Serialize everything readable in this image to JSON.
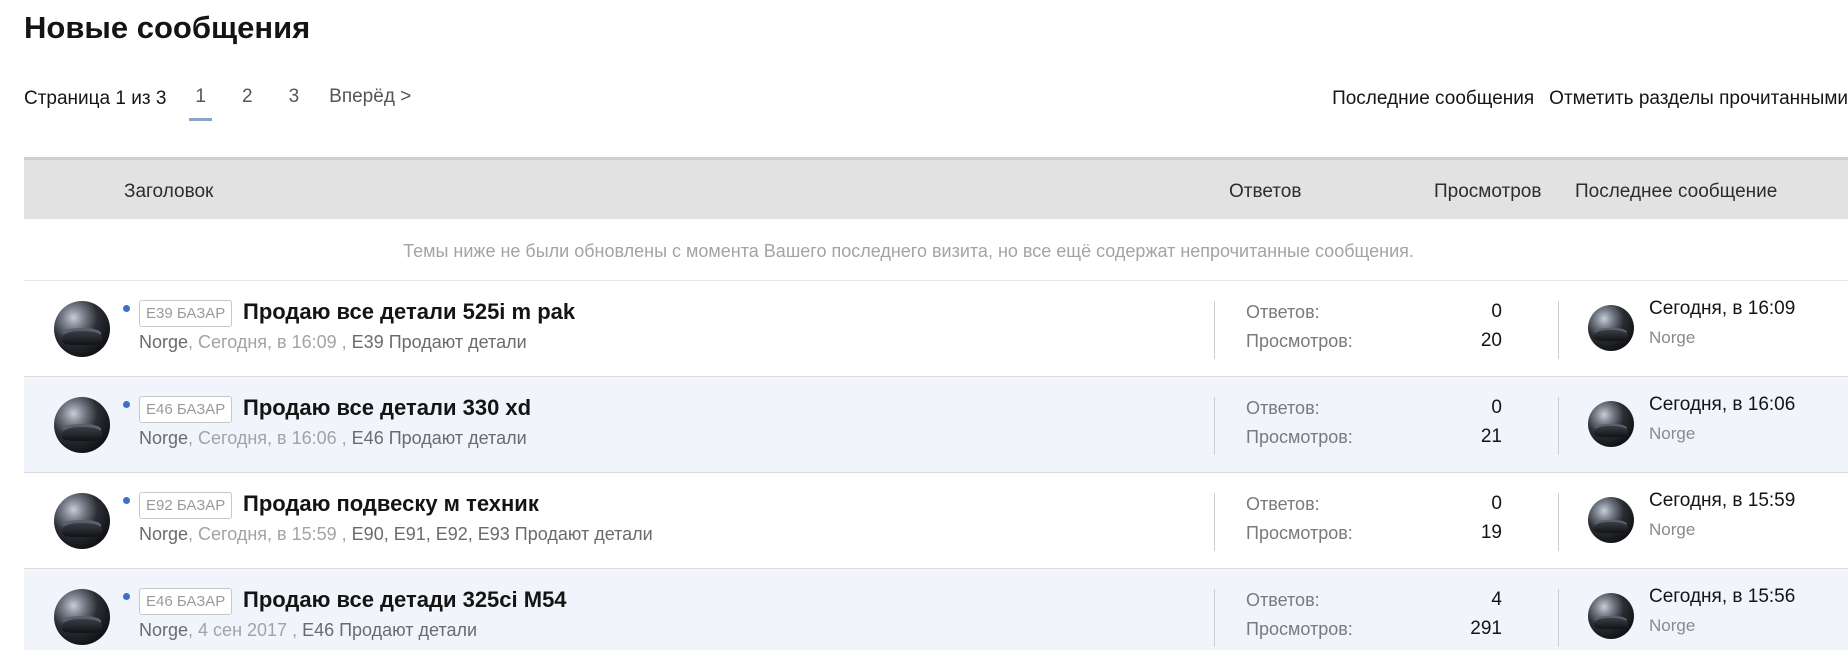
{
  "page": {
    "title": "Новые сообщения"
  },
  "pagination": {
    "label": "Страница 1 из 3",
    "pages": [
      "1",
      "2",
      "3"
    ],
    "current": "1",
    "next": "Вперёд >"
  },
  "top_links": {
    "recent_posts": "Последние сообщения",
    "mark_read": "Отметить разделы прочитанными"
  },
  "table": {
    "headers": {
      "title": "Заголовок",
      "replies": "Ответов",
      "views": "Просмотров",
      "last_post": "Последнее сообщение"
    },
    "notice": "Темы ниже не были обновлены с момента Вашего последнего визита, но все ещё содержат непрочитанные сообщения.",
    "stat_labels": {
      "replies": "Ответов:",
      "views": "Просмотров:"
    },
    "rows": [
      {
        "prefix": "E39 БАЗАР",
        "title": "Продаю все детали 525i m pak",
        "author": "Norge",
        "date": "Сегодня, в 16:09",
        "forum": "E39 Продают детали",
        "replies": "0",
        "views": "20",
        "last_date": "Сегодня, в 16:09",
        "last_user": "Norge"
      },
      {
        "prefix": "E46 БАЗАР",
        "title": "Продаю все детали 330 xd",
        "author": "Norge",
        "date": "Сегодня, в 16:06",
        "forum": "E46 Продают детали",
        "replies": "0",
        "views": "21",
        "last_date": "Сегодня, в 16:06",
        "last_user": "Norge"
      },
      {
        "prefix": "E92 БАЗАР",
        "title": "Продаю подвеску м техник",
        "author": "Norge",
        "date": "Сегодня, в 15:59",
        "forum": "E90, E91, E92, E93 Продают детали",
        "replies": "0",
        "views": "19",
        "last_date": "Сегодня, в 15:59",
        "last_user": "Norge"
      },
      {
        "prefix": "E46 БАЗАР",
        "title": "Продаю все детади 325ci M54",
        "author": "Norge",
        "date": "4 сен 2017",
        "forum": "E46 Продают детали",
        "replies": "4",
        "views": "291",
        "last_date": "Сегодня, в 15:56",
        "last_user": "Norge"
      }
    ]
  },
  "colors": {
    "header_bg": "#e2e2e2",
    "alt_row_bg": "#f2f4fb",
    "unread_dot": "#3d6ec9",
    "current_page_underline": "#8aa4c8"
  }
}
